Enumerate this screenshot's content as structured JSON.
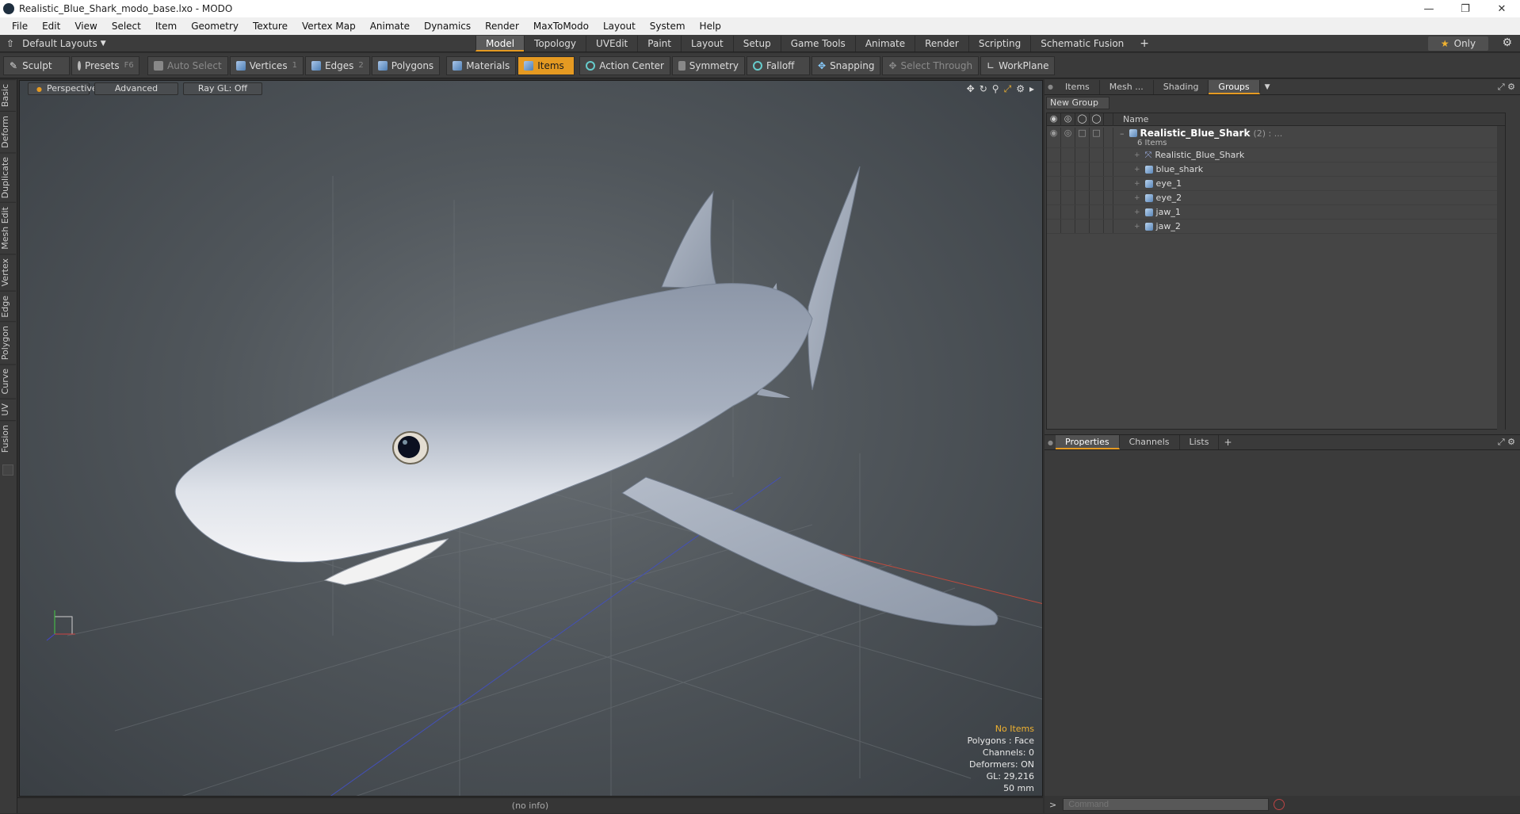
{
  "window": {
    "title": "Realistic_Blue_Shark_modo_base.lxo - MODO"
  },
  "menu": [
    "File",
    "Edit",
    "View",
    "Select",
    "Item",
    "Geometry",
    "Texture",
    "Vertex Map",
    "Animate",
    "Dynamics",
    "Render",
    "MaxToModo",
    "Layout",
    "System",
    "Help"
  ],
  "layout": {
    "selector": "Default Layouts",
    "tabs": [
      "Model",
      "Topology",
      "UVEdit",
      "Paint",
      "Layout",
      "Setup",
      "Game Tools",
      "Animate",
      "Render",
      "Scripting",
      "Schematic Fusion"
    ],
    "active_tab": "Model",
    "only_label": "Only"
  },
  "toolbar": {
    "sculpt": "Sculpt",
    "presets": "Presets",
    "presets_key": "F6",
    "auto_select": "Auto Select",
    "vertices": "Vertices",
    "vertices_key": "1",
    "edges": "Edges",
    "edges_key": "2",
    "polygons": "Polygons",
    "materials": "Materials",
    "items": "Items",
    "action_center": "Action Center",
    "symmetry": "Symmetry",
    "falloff": "Falloff",
    "snapping": "Snapping",
    "select_through": "Select Through",
    "workplane": "WorkPlane"
  },
  "left_tabs": [
    "Basic",
    "Deform",
    "Duplicate",
    "Mesh Edit",
    "Vertex",
    "Edge",
    "Polygon",
    "Curve",
    "UV",
    "Fusion"
  ],
  "viewport": {
    "view": "Perspective",
    "shading": "Advanced",
    "raygl": "Ray GL: Off",
    "info": {
      "items": "No Items",
      "polygons": "Polygons : Face",
      "channels": "Channels: 0",
      "deformers": "Deformers: ON",
      "gl": "GL: 29,216",
      "scale": "50 mm"
    }
  },
  "status": "(no info)",
  "right_panel": {
    "tabs": [
      "Items",
      "Mesh ...",
      "Shading",
      "Groups"
    ],
    "active_tab": "Groups",
    "new_group": "New Group",
    "name_header": "Name",
    "root": {
      "name": "Realistic_Blue_Shark",
      "count": "(2) : ...",
      "sub": "6 Items"
    },
    "items": [
      "Realistic_Blue_Shark",
      "blue_shark",
      "eye_1",
      "eye_2",
      "jaw_1",
      "jaw_2"
    ]
  },
  "bottom_panel": {
    "tabs": [
      "Properties",
      "Channels",
      "Lists"
    ],
    "active_tab": "Properties",
    "command_placeholder": "Command"
  }
}
